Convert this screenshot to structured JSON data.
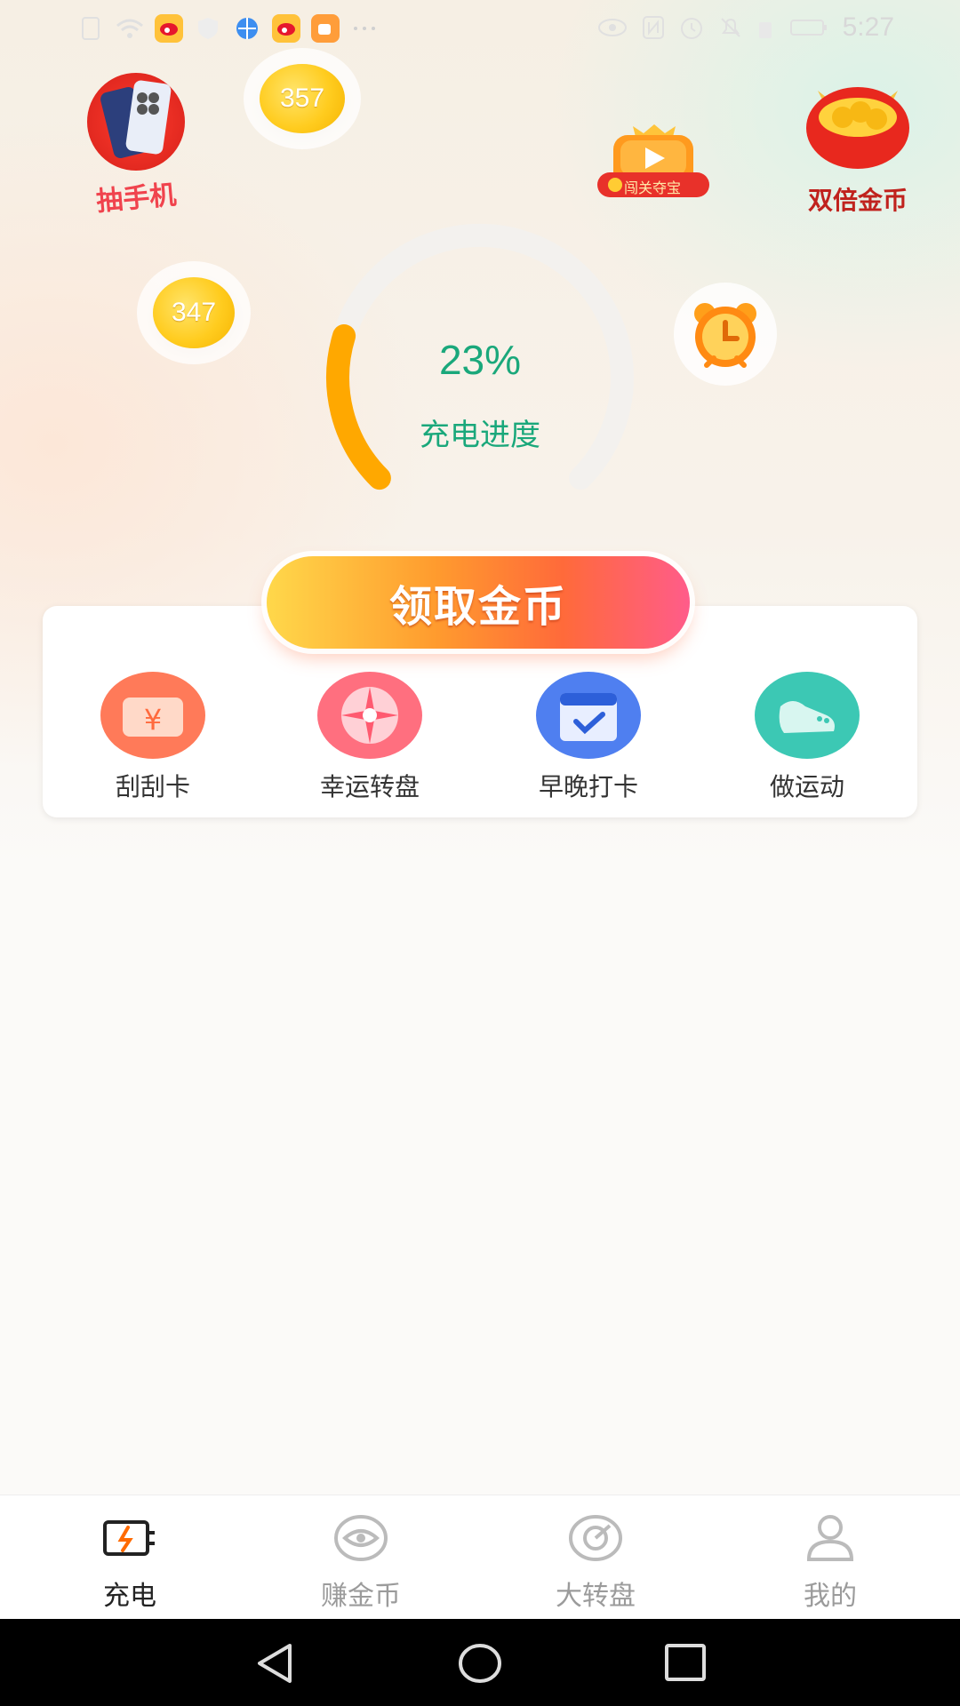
{
  "status_bar": {
    "time": "5:27"
  },
  "floating_coins": [
    {
      "value": "357"
    },
    {
      "value": "347"
    }
  ],
  "top_left": {
    "label": "抽手机"
  },
  "video_treasure": {
    "label": "闯关夺宝"
  },
  "double_coins": {
    "label": "双倍金币"
  },
  "charging": {
    "percent_text": "23%",
    "progress_fraction": 0.23,
    "label": "充电进度",
    "accent_color": "#ffa800",
    "text_color": "#1aa87b"
  },
  "claim_button": {
    "label": "领取金币"
  },
  "features": [
    {
      "label": "刮刮卡",
      "icon": "scratch-card-icon",
      "color": "#ff7a59"
    },
    {
      "label": "幸运转盘",
      "icon": "lucky-wheel-icon",
      "color": "#ff6f7f"
    },
    {
      "label": "早晚打卡",
      "icon": "calendar-check-icon",
      "color": "#4f7ff0"
    },
    {
      "label": "做运动",
      "icon": "sneaker-icon",
      "color": "#3cc8b4"
    }
  ],
  "bottom_nav": [
    {
      "label": "充电",
      "icon": "battery-charge-icon",
      "active": true
    },
    {
      "label": "赚金币",
      "icon": "eye-coin-icon",
      "active": false
    },
    {
      "label": "大转盘",
      "icon": "wheel-icon",
      "active": false
    },
    {
      "label": "我的",
      "icon": "user-icon",
      "active": false
    }
  ]
}
